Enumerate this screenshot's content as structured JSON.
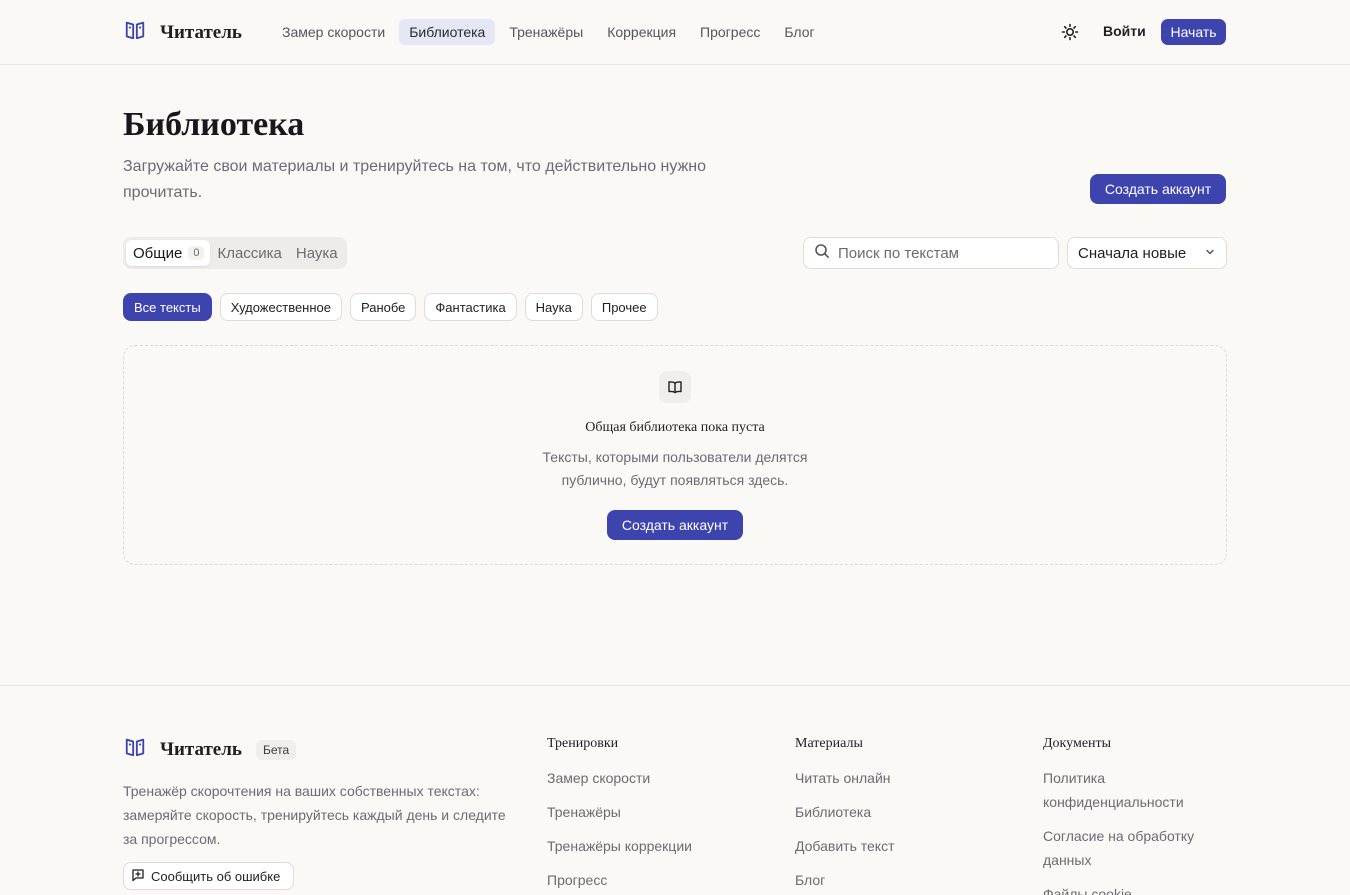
{
  "header": {
    "logo_text": "Читатель",
    "nav": [
      {
        "label": "Замер скорости",
        "active": false
      },
      {
        "label": "Библиотека",
        "active": true
      },
      {
        "label": "Тренажёры",
        "active": false
      },
      {
        "label": "Коррекция",
        "active": false
      },
      {
        "label": "Прогресс",
        "active": false
      },
      {
        "label": "Блог",
        "active": false
      }
    ],
    "login_label": "Войти",
    "start_label": "Начать"
  },
  "hero": {
    "title": "Библиотека",
    "subtitle": "Загружайте свои материалы и тренируйтесь на том, что действительно нужно прочитать.",
    "create_account_label": "Создать аккаунт"
  },
  "tabs": [
    {
      "label": "Общие",
      "count": "0",
      "active": true
    },
    {
      "label": "Классика",
      "active": false
    },
    {
      "label": "Наука",
      "active": false
    }
  ],
  "search": {
    "placeholder": "Поиск по текстам",
    "value": ""
  },
  "sort": {
    "selected": "Сначала новые"
  },
  "chips": [
    {
      "label": "Все тексты",
      "active": true
    },
    {
      "label": "Художественное",
      "active": false
    },
    {
      "label": "Ранобе",
      "active": false
    },
    {
      "label": "Фантастика",
      "active": false
    },
    {
      "label": "Наука",
      "active": false
    },
    {
      "label": "Прочее",
      "active": false
    }
  ],
  "empty_state": {
    "icon": "book-open-icon",
    "title": "Общая библиотека пока пуста",
    "text_line1": "Тексты, которыми пользователи делятся",
    "text_line2": "публично, будут появляться здесь.",
    "button_label": "Создать аккаунт"
  },
  "footer": {
    "logo_text": "Читатель",
    "beta_label": "Бета",
    "description": "Тренажёр скорочтения на ваших собственных текстах: замеряйте скорость, тренируйтесь каждый день и следите за прогрессом.",
    "report_label": "Сообщить об ошибке",
    "columns": [
      {
        "title": "Тренировки",
        "links": [
          "Замер скорости",
          "Тренажёры",
          "Тренажёры коррекции",
          "Прогресс"
        ]
      },
      {
        "title": "Материалы",
        "links": [
          "Читать онлайн",
          "Библиотека",
          "Добавить текст",
          "Блог"
        ]
      },
      {
        "title": "Документы",
        "links": [
          "Политика конфиденциальности",
          "Согласие на обработку данных",
          "Файлы cookie"
        ]
      }
    ]
  },
  "colors": {
    "accent": "#3d44ad",
    "background": "#faf9f6",
    "muted_text": "#6b6b73"
  }
}
